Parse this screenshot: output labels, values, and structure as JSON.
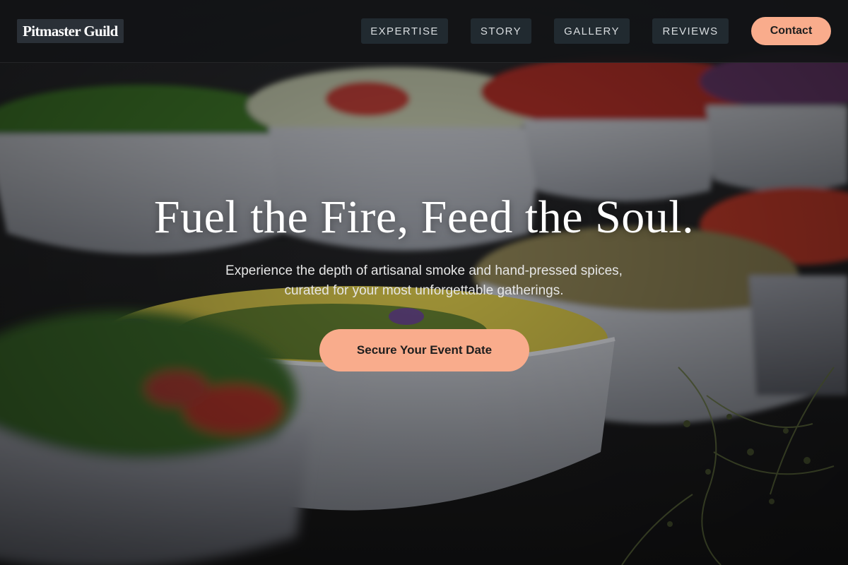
{
  "brand": {
    "logo_text": "Pitmaster Guild"
  },
  "nav": {
    "links": [
      {
        "label": "EXPERTISE"
      },
      {
        "label": "STORY"
      },
      {
        "label": "GALLERY"
      },
      {
        "label": "REVIEWS"
      }
    ],
    "contact_label": "Contact"
  },
  "hero": {
    "headline": "Fuel the Fire, Feed the Soul.",
    "subtext_line1": "Experience the depth of artisanal smoke and hand-pressed spices,",
    "subtext_line2": "curated for your most unforgettable gatherings.",
    "cta_label": "Secure Your Event Date",
    "background_description": "photo of salad bowls on a buffet table"
  },
  "colors": {
    "accent": "#f9ac8c",
    "nav_background": "#121416",
    "nav_link_background": "#212a30",
    "text_light": "#ffffff"
  }
}
